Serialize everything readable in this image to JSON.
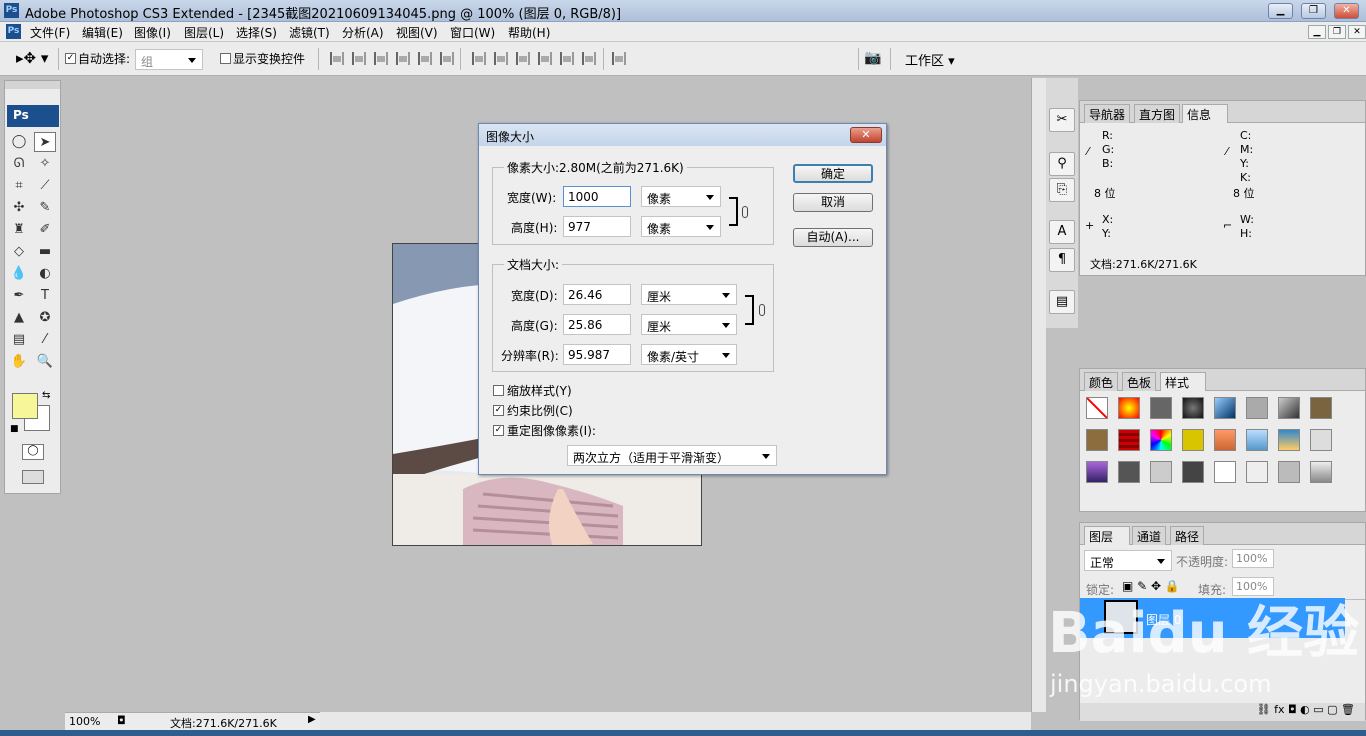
{
  "titlebar": {
    "title": "Adobe Photoshop CS3 Extended - [2345截图20210609134045.png @ 100% (图层 0, RGB/8)]",
    "app_icon": "Ps"
  },
  "menubar": {
    "items": [
      "文件(F)",
      "编辑(E)",
      "图像(I)",
      "图层(L)",
      "选择(S)",
      "滤镜(T)",
      "分析(A)",
      "视图(V)",
      "窗口(W)",
      "帮助(H)"
    ]
  },
  "options": {
    "auto_select_label": "自动选择:",
    "auto_select_value": "组",
    "show_transform_label": "显示变换控件",
    "workspace_label": "工作区"
  },
  "toolbox": {
    "logo": "Ps",
    "foreground": "#f7f79a",
    "background": "#ffffff"
  },
  "status": {
    "zoom": "100%",
    "doc": "文档:271.6K/271.6K"
  },
  "dialog": {
    "title": "图像大小",
    "pixel_group": "像素大小:2.80M(之前为271.6K)",
    "pixel_width_label": "宽度(W):",
    "pixel_width_value": "1000",
    "pixel_width_unit": "像素",
    "pixel_height_label": "高度(H):",
    "pixel_height_value": "977",
    "pixel_height_unit": "像素",
    "doc_group": "文档大小:",
    "doc_width_label": "宽度(D):",
    "doc_width_value": "26.46",
    "doc_width_unit": "厘米",
    "doc_height_label": "高度(G):",
    "doc_height_value": "25.86",
    "doc_height_unit": "厘米",
    "resolution_label": "分辨率(R):",
    "resolution_value": "95.987",
    "resolution_unit": "像素/英寸",
    "scale_styles": "缩放样式(Y)",
    "constrain": "约束比例(C)",
    "resample": "重定图像像素(I):",
    "resample_method": "两次立方（适用于平滑渐变）",
    "ok": "确定",
    "cancel": "取消",
    "auto": "自动(A)..."
  },
  "info_panel": {
    "tabs": [
      "导航器",
      "直方图",
      "信息"
    ],
    "r": "R:",
    "g": "G:",
    "b": "B:",
    "c": "C:",
    "m": "M:",
    "y": "Y:",
    "k": "K:",
    "bits_left": "8 位",
    "bits_right": "8 位",
    "x": "X:",
    "yy": "Y:",
    "w": "W:",
    "h": "H:",
    "doc": "文档:271.6K/271.6K"
  },
  "styles_panel": {
    "tabs": [
      "颜色",
      "色板",
      "样式"
    ]
  },
  "layers_panel": {
    "tabs": [
      "图层",
      "通道",
      "路径"
    ],
    "blend": "正常",
    "opacity_label": "不透明度:",
    "opacity": "100%",
    "lock_label": "锁定:",
    "fill_label": "填充:",
    "fill": "100%",
    "layer_name": "图层 0"
  },
  "watermark": {
    "line1": "Baidu 经验",
    "line2": "jingyan.baidu.com"
  }
}
